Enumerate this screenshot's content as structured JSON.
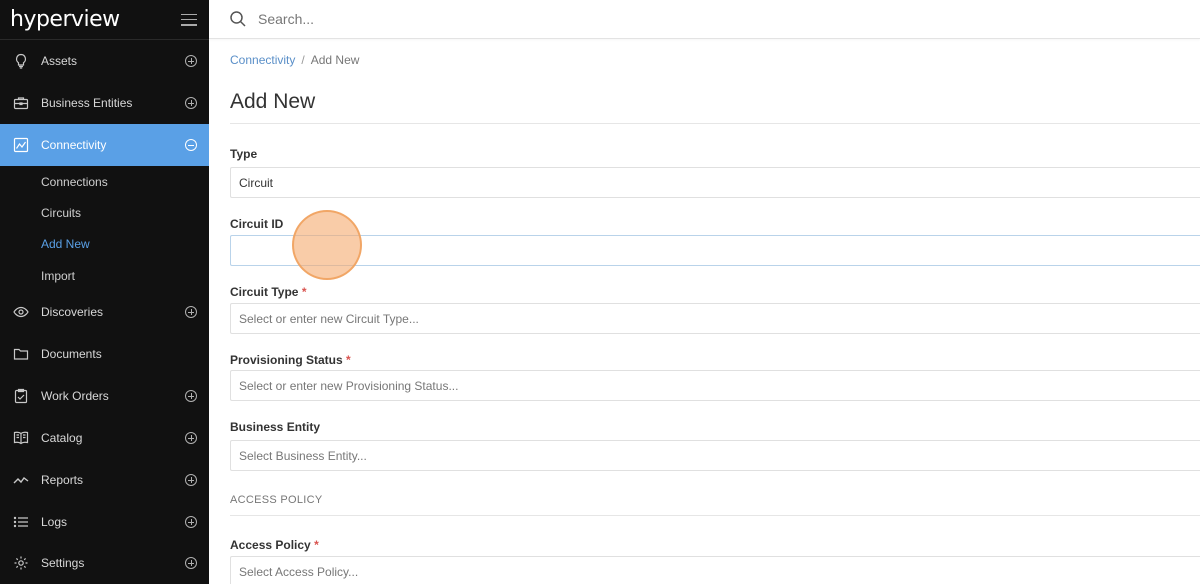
{
  "brand": {
    "logo_text": "hyperview"
  },
  "search": {
    "placeholder": "Search..."
  },
  "sidebar": {
    "items": [
      {
        "label": "Assets"
      },
      {
        "label": "Business Entities"
      },
      {
        "label": "Connectivity"
      },
      {
        "label": "Discoveries"
      },
      {
        "label": "Documents"
      },
      {
        "label": "Work Orders"
      },
      {
        "label": "Catalog"
      },
      {
        "label": "Reports"
      },
      {
        "label": "Logs"
      },
      {
        "label": "Settings"
      }
    ],
    "sub_items": [
      {
        "label": "Connections"
      },
      {
        "label": "Circuits"
      },
      {
        "label": "Add New"
      },
      {
        "label": "Import"
      }
    ]
  },
  "breadcrumb": {
    "parent": "Connectivity",
    "separator": "/",
    "current": "Add New"
  },
  "page": {
    "title": "Add New"
  },
  "form": {
    "type": {
      "label": "Type",
      "value": "Circuit"
    },
    "circuit_id": {
      "label": "Circuit ID",
      "value": ""
    },
    "circuit_type": {
      "label": "Circuit Type",
      "required_mark": "*",
      "placeholder": "Select or enter new Circuit Type..."
    },
    "provisioning_status": {
      "label": "Provisioning Status",
      "required_mark": "*",
      "placeholder": "Select or enter new Provisioning Status..."
    },
    "business_entity": {
      "label": "Business Entity",
      "placeholder": "Select Business Entity..."
    },
    "access_section": {
      "heading": "ACCESS POLICY"
    },
    "access_policy": {
      "label": "Access Policy",
      "required_mark": "*",
      "placeholder": "Select Access Policy..."
    }
  },
  "colors": {
    "sidebar_bg": "#111111",
    "active_nav": "#5aa0e6",
    "link": "#5a8fc8",
    "required": "#d9534f"
  }
}
